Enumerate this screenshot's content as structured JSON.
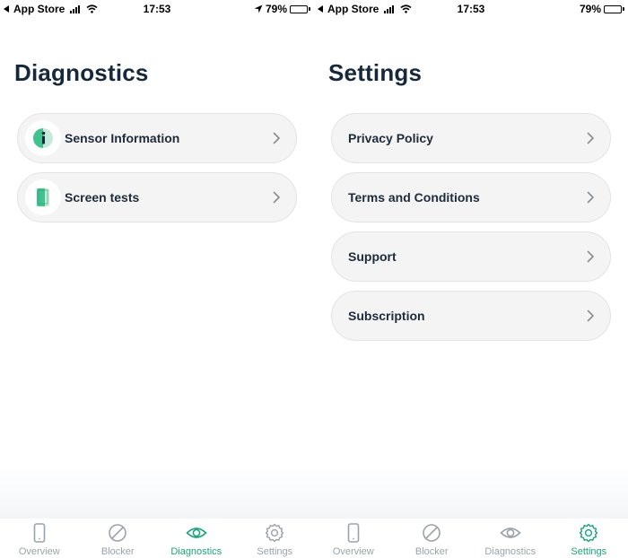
{
  "colors": {
    "accent": "#1aa57a",
    "inactive": "#9aa3ab",
    "title": "#16283c",
    "card_bg": "#f4f4f4"
  },
  "left": {
    "status": {
      "back_label": "App Store",
      "time": "17:53",
      "battery": "79%",
      "location_icon": "location-arrow-icon"
    },
    "title": "Diagnostics",
    "items": [
      {
        "label": "Sensor Information",
        "icon": "info-icon"
      },
      {
        "label": "Screen tests",
        "icon": "phone-screen-icon"
      }
    ],
    "tabs": [
      {
        "label": "Overview",
        "icon": "phone-icon",
        "active": false
      },
      {
        "label": "Blocker",
        "icon": "block-icon",
        "active": false
      },
      {
        "label": "Diagnostics",
        "icon": "eye-icon",
        "active": true
      },
      {
        "label": "Settings",
        "icon": "gear-icon",
        "active": false
      }
    ]
  },
  "right": {
    "status": {
      "back_label": "App Store",
      "time": "17:53",
      "battery": "79%"
    },
    "title": "Settings",
    "items": [
      {
        "label": "Privacy Policy"
      },
      {
        "label": "Terms and Conditions"
      },
      {
        "label": "Support"
      },
      {
        "label": "Subscription"
      }
    ],
    "tabs": [
      {
        "label": "Overview",
        "icon": "phone-icon",
        "active": false
      },
      {
        "label": "Blocker",
        "icon": "block-icon",
        "active": false
      },
      {
        "label": "Diagnostics",
        "icon": "eye-icon",
        "active": false
      },
      {
        "label": "Settings",
        "icon": "gear-icon",
        "active": true
      }
    ]
  }
}
